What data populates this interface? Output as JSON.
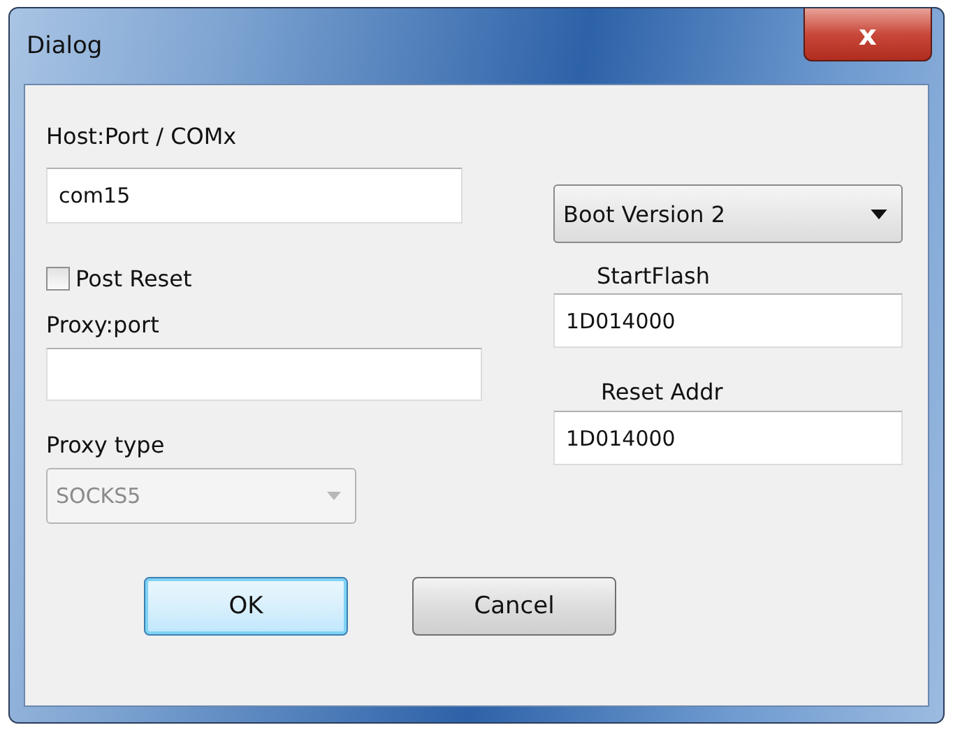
{
  "window": {
    "title": "Dialog",
    "close_symbol": "x"
  },
  "host_port": {
    "label": "Host:Port / COMx",
    "value": "com15"
  },
  "boot_version": {
    "value": "Boot Version 2"
  },
  "post_reset": {
    "label": "Post Reset",
    "checked": false
  },
  "start_flash": {
    "label": "StartFlash",
    "value": "1D014000"
  },
  "proxy_port": {
    "label": "Proxy:port"
  },
  "reset_addr": {
    "label": "Reset Addr",
    "value": "1D014000"
  },
  "proxy_type": {
    "label": "Proxy type",
    "value": "SOCKS5",
    "disabled": true
  },
  "buttons": [
    {
      "label": "OK",
      "default": true
    },
    {
      "label": "Cancel",
      "default": false
    }
  ]
}
